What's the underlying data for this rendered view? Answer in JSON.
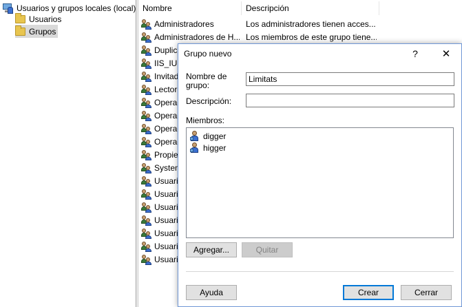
{
  "tree": {
    "root": "Usuarios y grupos locales (local)",
    "children": [
      "Usuarios",
      "Grupos"
    ],
    "selected": "Grupos"
  },
  "list": {
    "columns": [
      "Nombre",
      "Descripción"
    ],
    "rows": [
      {
        "name": "Administradores",
        "desc": "Los administradores tienen acces..."
      },
      {
        "name": "Administradores de H...",
        "desc": "Los miembros de este grupo tiene..."
      },
      {
        "name": "Duplica",
        "desc": ""
      },
      {
        "name": "IIS_IUS",
        "desc": ""
      },
      {
        "name": "Invitad",
        "desc": ""
      },
      {
        "name": "Lectore",
        "desc": ""
      },
      {
        "name": "Operac",
        "desc": ""
      },
      {
        "name": "Operad",
        "desc": ""
      },
      {
        "name": "Operad",
        "desc": ""
      },
      {
        "name": "Operad",
        "desc": ""
      },
      {
        "name": "Propie",
        "desc": ""
      },
      {
        "name": "System",
        "desc": ""
      },
      {
        "name": "Usuario",
        "desc": ""
      },
      {
        "name": "Usuario",
        "desc": ""
      },
      {
        "name": "Usuario",
        "desc": ""
      },
      {
        "name": "Usuario",
        "desc": ""
      },
      {
        "name": "Usuario",
        "desc": ""
      },
      {
        "name": "Usuario",
        "desc": ""
      },
      {
        "name": "Usuario",
        "desc": ""
      }
    ]
  },
  "dialog": {
    "title": "Grupo nuevo",
    "help_glyph": "?",
    "close_glyph": "✕",
    "group_name_label": "Nombre de grupo:",
    "group_name_value": "Limitats",
    "description_label": "Descripción:",
    "description_value": "",
    "members_label": "Miembros:",
    "members": [
      "digger",
      "higger"
    ],
    "add_button": "Agregar...",
    "remove_button": "Quitar",
    "help_button": "Ayuda",
    "create_button": "Crear",
    "close_button": "Cerrar"
  },
  "icons": {
    "tree_root": "computer-users-icon",
    "folder": "folder-icon",
    "group": "group-icon",
    "user": "user-icon"
  }
}
